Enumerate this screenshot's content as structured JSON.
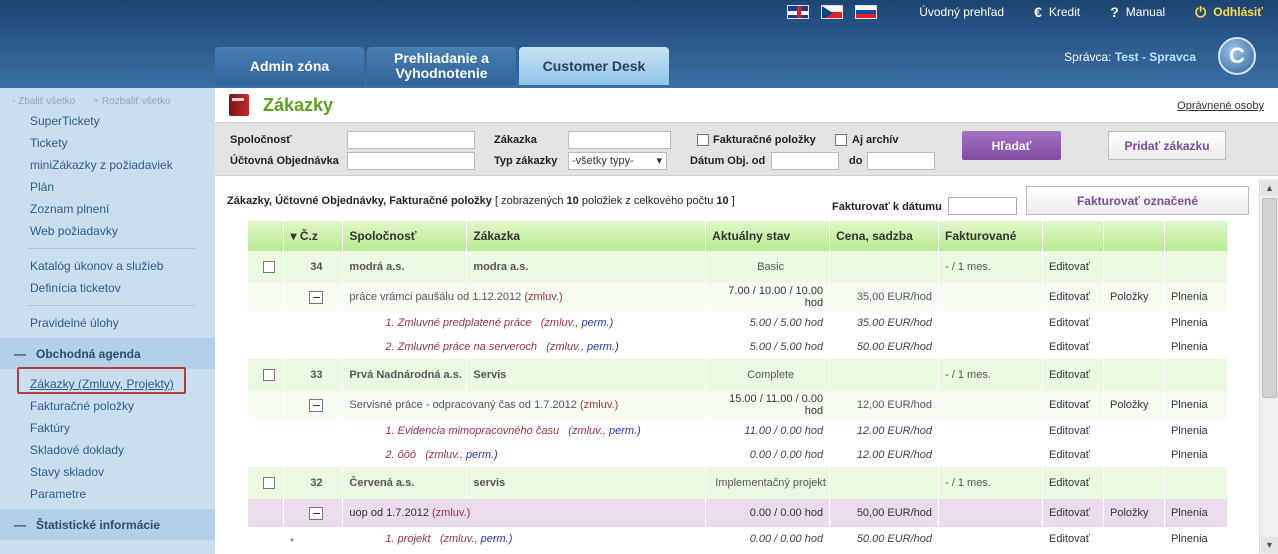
{
  "topbar": {
    "home": "Úvodný prehľad",
    "credit_icon": "€",
    "credit": "Kredit",
    "manual_icon": "?",
    "manual": "Manual",
    "logout_icon": "⏻",
    "logout": "Odhlásiť"
  },
  "tabs": [
    {
      "label": "Admin zóna"
    },
    {
      "label": "Prehliadanie a Vyhodnotenie"
    },
    {
      "label": "Customer Desk"
    }
  ],
  "admin": {
    "prefix": "Správca:",
    "user": "Test - Spravca"
  },
  "logo": "C",
  "sidebar": {
    "collapse_all": "- Zbaliť všetko",
    "expand_all": "+ Rozbaliť všetko",
    "items1": [
      "SuperTickety",
      "Tickety",
      "miniZákazky z požiadaviek",
      "Plán",
      "Zoznam plnení",
      "Web požiadavky"
    ],
    "items2": [
      "Katalóg úkonov a služieb",
      "Definícia ticketov"
    ],
    "items3": [
      "Pravidelné úlohy"
    ],
    "section1": "Obchodná agenda",
    "items4": [
      "Zákazky (Zmluvy, Projekty)",
      "Fakturačné položky",
      "Faktúry",
      "Skladové doklady",
      "Stavy skladov",
      "Parametre"
    ],
    "section2": "Štatistické informácie"
  },
  "page": {
    "title": "Zákazky",
    "authorized_link": "Oprávnené osoby"
  },
  "filter": {
    "company": "Spoločnosť",
    "order": "Zákazka",
    "billing_items": "Fakturačné položky",
    "archive": "Aj archív",
    "account_order": "Účtovná Objednávka",
    "order_type": "Typ zákazky",
    "order_type_value": "-všetky typy-",
    "date_from": "Dátum Obj. od",
    "date_to": "do",
    "search_button": "Hľadať",
    "add_button": "Pridať zákazku"
  },
  "list": {
    "info_prefix": "Zákazky, Účtovné Objednávky, Fakturačné položky",
    "info_mid1": "[ zobrazených",
    "shown": "10",
    "info_mid2": "položiek z celkového počtu",
    "total": "10",
    "info_end": "]",
    "bill_date_label": "Fakturovať k dátumu",
    "bill_button": "Fakturovať označené"
  },
  "table": {
    "headers": [
      "",
      "▾ Č.z",
      "Spoločnosť",
      "Zákazka",
      "Aktuálny stav",
      "Cena, sadzba",
      "Fakturované",
      "",
      "",
      ""
    ],
    "actions": {
      "edit": "Editovať",
      "items": "Položky",
      "fulfil": "Plnenia"
    },
    "groups": [
      {
        "num": "34",
        "company": "modrá a.s.",
        "order": "modra a.s.",
        "status": "Basic",
        "billed": "- / 1 mes.",
        "sub": {
          "desc": "práce vrámci paušálu od 1.12.2012",
          "tag": "(zmluv.)",
          "status": "7.00 / 10.00 / 10.00 hod",
          "price": "35,00 EUR/hod"
        },
        "items": [
          {
            "name": "1. Zmluvné predplatené práce",
            "z": "(zmluv.,",
            "p": "perm.)",
            "val": "5.00 / 5.00 hod",
            "price": "35.00 EUR/hod"
          },
          {
            "name": "2. Zmluvné práce na serveroch",
            "z": "(zmluv.,",
            "p": "perm.)",
            "val": "5.00 / 5.00 hod",
            "price": "50.00 EUR/hod"
          }
        ]
      },
      {
        "num": "33",
        "company": "Prvá Nadnárodná a.s.",
        "order": "Servis",
        "status": "Complete",
        "billed": "- / 1 mes.",
        "sub": {
          "desc": "Servisné práce - odpracovaný čas od 1.7.2012",
          "tag": "(zmluv.)",
          "status": "15.00 / 11.00 / 0.00 hod",
          "price": "12,00 EUR/hod"
        },
        "items": [
          {
            "name": "1. Evidencia mimopracovného času",
            "z": "(zmluv.,",
            "p": "perm.)",
            "val": "11.00 / 0.00 hod",
            "price": "12.00 EUR/hod"
          },
          {
            "name": "2. ôôô",
            "z": "(zmluv.,",
            "p": "perm.)",
            "val": "0.00 / 0.00 hod",
            "price": "12.00 EUR/hod"
          }
        ]
      },
      {
        "num": "32",
        "company": "Červená a.s.",
        "order": "servis",
        "status": "Implementačný projekt",
        "billed": "- / 1 mes.",
        "sub": {
          "desc": "uop od 1.7.2012",
          "tag": "(zmluv.)",
          "status": "0.00 / 0.00 hod",
          "price": "50,00 EUR/hod"
        },
        "items": [
          {
            "name": "1. projekt",
            "z": "(zmluv.,",
            "p": "perm.)",
            "val": "0.00 / 0.00 hod",
            "price": "50.00 EUR/hod"
          }
        ]
      }
    ],
    "star": "*"
  }
}
